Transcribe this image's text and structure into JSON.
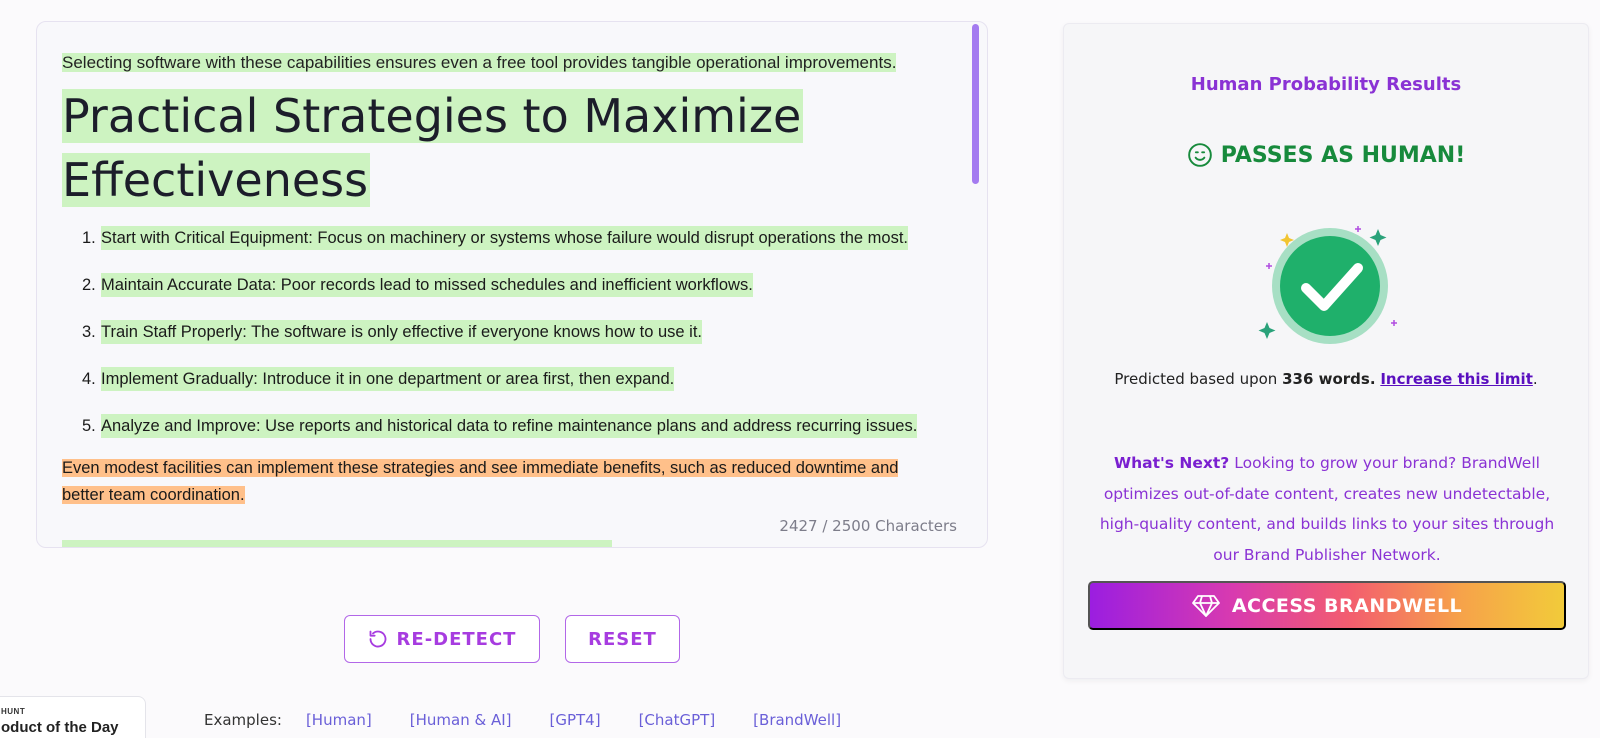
{
  "editor": {
    "intro": "Selecting software with these capabilities ensures even a free tool provides tangible operational improvements.",
    "heading": "Practical Strategies to Maximize Effectiveness",
    "steps": [
      {
        "num": "1.",
        "text": "Start with Critical Equipment: Focus on machinery or systems whose failure would disrupt operations the most."
      },
      {
        "num": "2.",
        "text": "Maintain Accurate Data: Poor records lead to missed schedules and inefficient workflows."
      },
      {
        "num": "3.",
        "text": "Train Staff Properly: The software is only effective if everyone knows how to use it."
      },
      {
        "num": "4.",
        "text": "Implement Gradually: Introduce it in one department or area first, then expand."
      },
      {
        "num": "5.",
        "text": "Analyze and Improve: Use reports and historical data to refine maintenance plans and address recurring issues."
      }
    ],
    "outro": "Even modest facilities can implement these strategies and see immediate benefits, such as reduced downtime and better team coordination.",
    "char_count": "2427 / 2500 Characters",
    "colors": {
      "human_highlight": "#cdf3c1",
      "mixed_highlight": "#ffc08a"
    }
  },
  "actions": {
    "redetect_label": "RE-DETECT",
    "reset_label": "RESET"
  },
  "examples": {
    "label": "Examples:",
    "items": [
      "[Human]",
      "[Human & AI]",
      "[GPT4]",
      "[ChatGPT]",
      "[BrandWell]"
    ]
  },
  "badge": {
    "small": "HUNT",
    "big": "oduct of the Day"
  },
  "results": {
    "title": "Human Probability Results",
    "verdict": "PASSES AS HUMAN!",
    "predicted_prefix": "Predicted based upon",
    "word_count": "336 words.",
    "increase_link": "Increase this limit",
    "whats_next_label": "What's Next?",
    "whats_next_text": "Looking to grow your brand? BrandWell optimizes out-of-date content, creates new undetectable, high-quality content, and builds links to your sites through our Brand Publisher Network.",
    "access_label": "ACCESS BRANDWELL",
    "colors": {
      "pass": "#178a3c",
      "accent": "#8a32d4"
    }
  }
}
